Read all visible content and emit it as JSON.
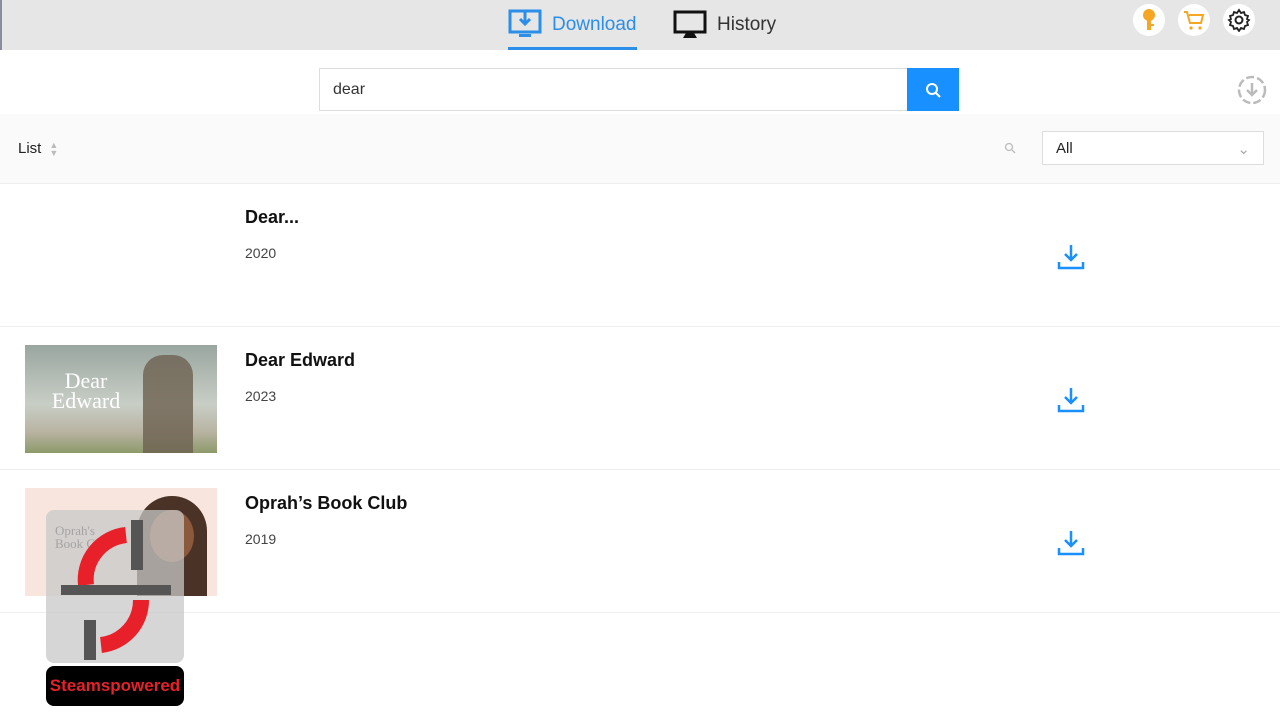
{
  "tabs": [
    {
      "label": "Download",
      "icon": "download-monitor-icon",
      "active": true
    },
    {
      "label": "History",
      "icon": "monitor-icon",
      "active": false
    }
  ],
  "header_icons": [
    "key-icon",
    "cart-icon",
    "gear-icon"
  ],
  "colors": {
    "accent": "#1890ff",
    "key": "#f5a623"
  },
  "search": {
    "value": "dear",
    "button_icon": "search-icon"
  },
  "list": {
    "label": "List",
    "filter": "All"
  },
  "results": [
    {
      "title": "Dear...",
      "year": "2020",
      "has_thumbnail": false
    },
    {
      "title": "Dear Edward",
      "year": "2023",
      "has_thumbnail": true,
      "thumb_text": "Dear Edward"
    },
    {
      "title": "Oprah’s Book Club",
      "year": "2019",
      "has_thumbnail": true,
      "thumb_text": "Oprah's Book Club"
    }
  ],
  "watermark": {
    "text": "Steamspowered"
  }
}
